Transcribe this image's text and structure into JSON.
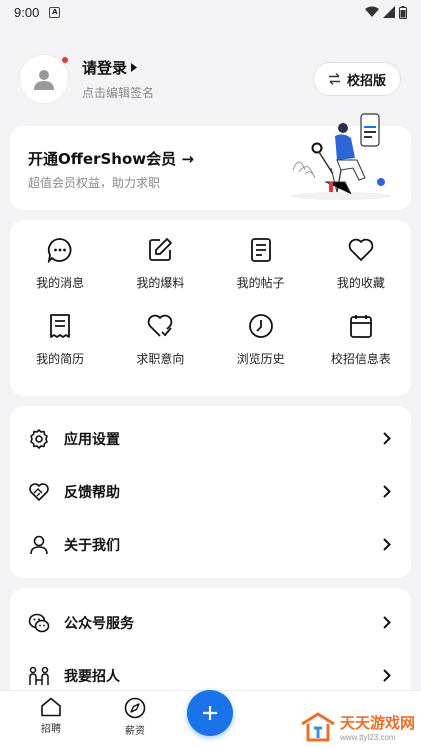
{
  "status_bar": {
    "time": "9:00"
  },
  "profile": {
    "login_label": "请登录",
    "signature_placeholder": "点击编辑签名",
    "campus_button": "校招版"
  },
  "vip": {
    "title": "开通OfferShow会员 →",
    "subtitle": "超值会员权益，助力求职"
  },
  "grid": [
    {
      "label": "我的消息",
      "icon": "message-icon"
    },
    {
      "label": "我的爆料",
      "icon": "edit-icon"
    },
    {
      "label": "我的帖子",
      "icon": "document-icon"
    },
    {
      "label": "我的收藏",
      "icon": "heart-icon"
    },
    {
      "label": "我的简历",
      "icon": "resume-icon"
    },
    {
      "label": "求职意向",
      "icon": "heart-check-icon"
    },
    {
      "label": "浏览历史",
      "icon": "clock-icon"
    },
    {
      "label": "校招信息表",
      "icon": "calendar-icon"
    }
  ],
  "menu": [
    {
      "label": "应用设置",
      "icon": "gear-icon"
    },
    {
      "label": "反馈帮助",
      "icon": "handshake-icon"
    },
    {
      "label": "关于我们",
      "icon": "person-icon"
    }
  ],
  "menu2": [
    {
      "label": "公众号服务",
      "icon": "wechat-icon"
    },
    {
      "label": "我要招人",
      "icon": "recruit-icon"
    }
  ],
  "bottom_nav": {
    "recruit": "招聘",
    "salary": "薪资"
  },
  "watermark": {
    "title": "天天游戏网",
    "url": "www.ttyl23.com"
  },
  "colors": {
    "accent": "#1a73e8",
    "watermark": "#e8702a"
  }
}
